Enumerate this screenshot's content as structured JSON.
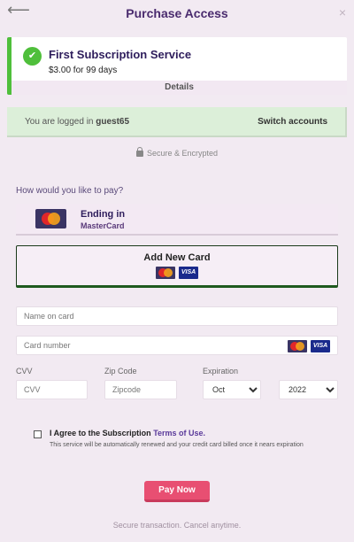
{
  "header": {
    "back_glyph": "⟵",
    "title": "Purchase Access",
    "close_glyph": "×"
  },
  "subscription": {
    "check_glyph": "✔",
    "title": "First Subscription Service",
    "price": "$3.00 for 99 days",
    "details_label": "Details"
  },
  "login": {
    "prefix": "You are logged in",
    "username": "guest65",
    "switch_label": "Switch accounts"
  },
  "secure": {
    "label": "Secure & Encrypted"
  },
  "payment": {
    "question": "How would you like to pay?",
    "saved_card": {
      "title": "Ending in",
      "brand": "MasterCard"
    },
    "add_card": {
      "title": "Add New Card",
      "visa_text": "VISA"
    }
  },
  "form": {
    "name_placeholder": "Name on card",
    "number_placeholder": "Card number",
    "visa_text": "VISA",
    "cvv_label": "CVV",
    "cvv_placeholder": "CVV",
    "zip_label": "Zip Code",
    "zip_placeholder": "Zipcode",
    "expiration_label": "Expiration",
    "month_selected": "Oct",
    "year_selected": "2022"
  },
  "agreement": {
    "prefix": "I Agree to the Subscription",
    "link": "Terms of Use.",
    "note": "This service will be automatically renewed and your credit card billed once it nears expiration"
  },
  "actions": {
    "pay_label": "Pay Now",
    "footer": "Secure transaction. Cancel anytime."
  },
  "colors": {
    "accent_purple": "#4a2b6e",
    "success_green": "#4fbf3b",
    "pay_button": "#e84f72",
    "login_bg": "#dcefd9"
  }
}
